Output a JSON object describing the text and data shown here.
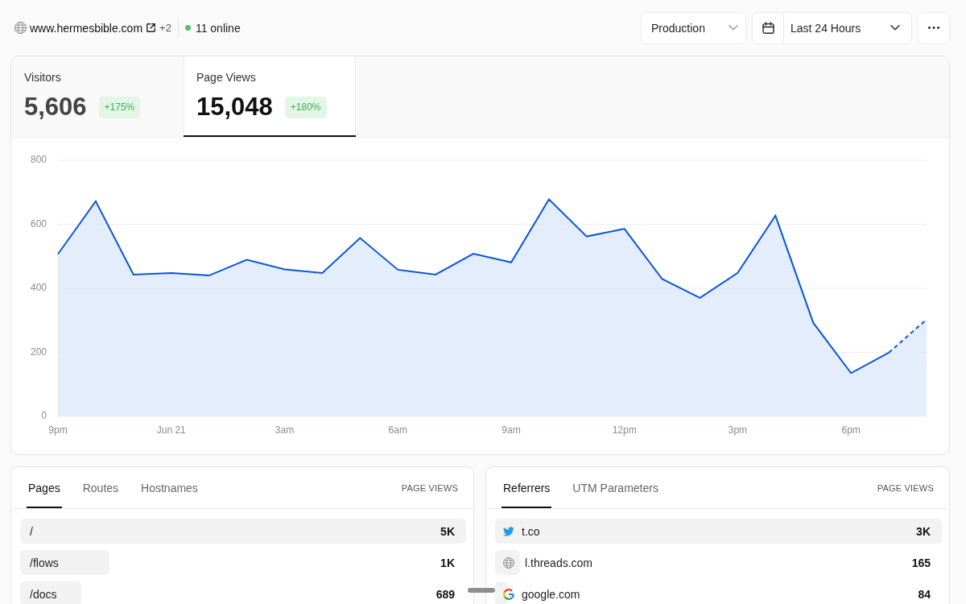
{
  "header": {
    "site": "www.hermesbible.com",
    "extra_domains": "+2",
    "online": "11 online"
  },
  "controls": {
    "environment": "Production",
    "date_range": "Last 24 Hours"
  },
  "metrics": [
    {
      "label": "Visitors",
      "value": "5,606",
      "change": "+175%",
      "selected": false
    },
    {
      "label": "Page Views",
      "value": "15,048",
      "change": "+180%",
      "selected": true
    }
  ],
  "chart": {
    "last_point_incomplete": true,
    "chart_data": {
      "type": "area",
      "categories": [
        "9pm",
        null,
        null,
        "Jun 21",
        null,
        null,
        "3am",
        null,
        null,
        "6am",
        null,
        null,
        "9am",
        null,
        null,
        "12pm",
        null,
        null,
        "3pm",
        null,
        null,
        "6pm",
        null,
        null
      ],
      "values": [
        507,
        672,
        443,
        448,
        440,
        489,
        459,
        448,
        557,
        458,
        443,
        508,
        481,
        678,
        562,
        586,
        429,
        370,
        448,
        627,
        292,
        135,
        199,
        303
      ],
      "ylim": [
        0,
        800
      ],
      "yticks": [
        0,
        200,
        400,
        600,
        800
      ],
      "grid": true
    }
  },
  "panels": [
    {
      "tabs": [
        {
          "label": "Pages",
          "selected": true
        },
        {
          "label": "Routes",
          "selected": false
        },
        {
          "label": "Hostnames",
          "selected": false
        }
      ],
      "column_header": "PAGE VIEWS",
      "rows": [
        {
          "label": "/",
          "value": "5K",
          "level": 1
        },
        {
          "label": "/flows",
          "value": "1K",
          "level": 0.2
        },
        {
          "label": "/docs",
          "value": "689",
          "level": 0.138
        }
      ]
    },
    {
      "tabs": [
        {
          "label": "Referrers",
          "selected": true
        },
        {
          "label": "UTM Parameters",
          "selected": false
        }
      ],
      "column_header": "PAGE VIEWS",
      "rows": [
        {
          "label": "t.co",
          "value": "3K",
          "level": 1
        },
        {
          "label": "l.threads.com",
          "value": "165",
          "level": 0.055
        },
        {
          "label": "google.com",
          "value": "84",
          "level": 0.028
        }
      ]
    }
  ]
}
